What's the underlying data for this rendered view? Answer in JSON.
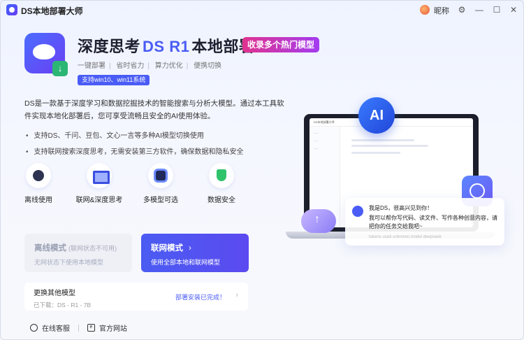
{
  "titlebar": {
    "app_title": "DS本地部署大师",
    "user_name": "昵称",
    "min": "—",
    "max": "☐",
    "close": "✕",
    "settings": "⚙"
  },
  "hero": {
    "title_a": "深度思考",
    "title_b": "DS R1",
    "title_c": "本地部署",
    "tag": "收录多个热门模型",
    "features": [
      "一键部署",
      "省时省力",
      "算力优化",
      "便携切换"
    ],
    "os_badge": "支持win10、win11系统"
  },
  "desc": "DS是一款基于深度学习和数据挖掘技术的智能搜索与分析大模型。通过本工具软件实现本地化部署后，您可享受流畅且安全的AI使用体验。",
  "bullets": [
    "支持DS、千问、豆包、文心一言等多种AI模型切换使用",
    "支持联网搜索深度思考，无需安装第三方软件，确保数据和隐私安全"
  ],
  "feature_icons": [
    {
      "label": "离线使用",
      "icon": "offline-icon"
    },
    {
      "label": "联网&深度思考",
      "icon": "network-icon"
    },
    {
      "label": "多模型可选",
      "icon": "chip-icon"
    },
    {
      "label": "数据安全",
      "icon": "shield-icon"
    }
  ],
  "modes": {
    "offline": {
      "title": "离线模式",
      "note": "(联网状态不可用)",
      "sub": "无网状态下使用本地模型"
    },
    "online": {
      "title": "联网模式",
      "sub": "使用全部本地和联网模型"
    }
  },
  "more": {
    "title": "更换其他模型",
    "downloaded": "已下载：DS - R1 - 7B",
    "status": "部署安装已完成！"
  },
  "footer": {
    "service": "在线客服",
    "site": "官方网站"
  },
  "illustration": {
    "ai_label": "AI",
    "screen_title": "DS本地部署大师",
    "bubble_greeting": "我是DS，很高兴见到你！",
    "bubble_body": "我可以帮你写代码、读文件、写作各种创意内容，请把你的任务交给我吧~",
    "bubble_meta": "tokens used unknown,model deepseek"
  },
  "colors": {
    "accent": "#4a5cf5",
    "tag_start": "#e0338f",
    "tag_end": "#a33cf0"
  }
}
